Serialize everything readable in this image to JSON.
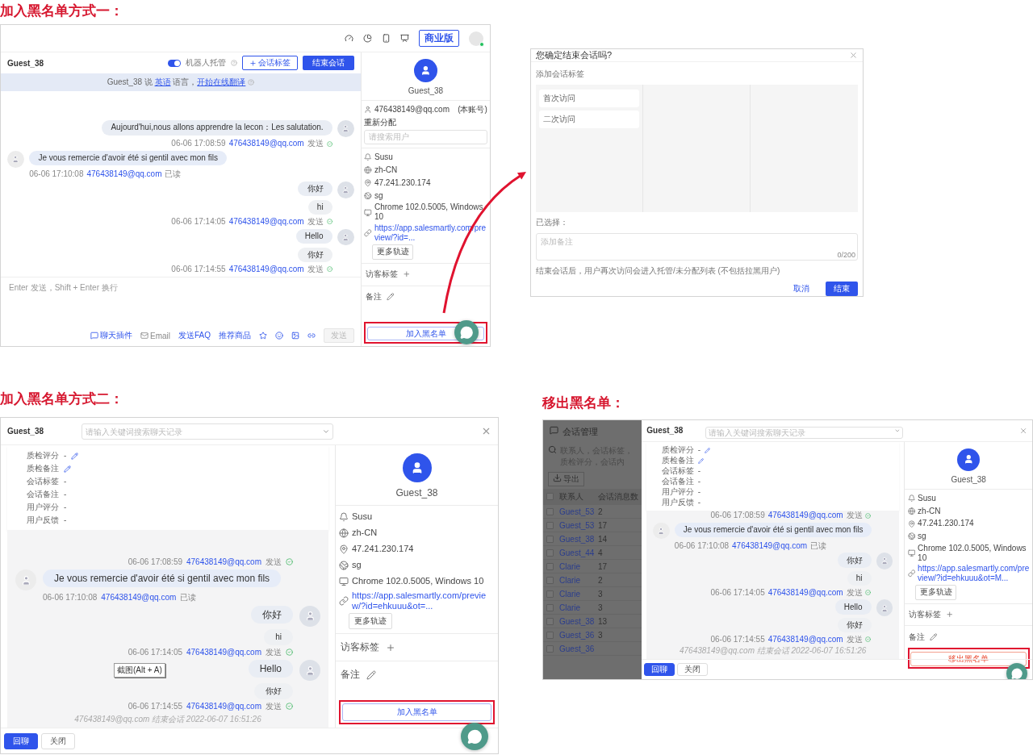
{
  "method_one": {
    "heading": "加入黑名单方式一：",
    "workspace": {
      "topbar": {
        "plan_badge": "商业版",
        "online": true
      },
      "chat": {
        "guest": "Guest_38",
        "robot_toggle": {
          "label": "机器人托管",
          "on": true
        },
        "tag_button": "会话标签",
        "end_button": "结束会话",
        "translate_notice": [
          {
            "text": "Guest_38 说 ",
            "link": false
          },
          {
            "text": "英语",
            "link": true
          },
          {
            "text": " 语言，",
            "link": false
          },
          {
            "text": "开始在线翻译",
            "link": true
          }
        ],
        "messages": [
          {
            "kind": "sent",
            "bubbles": [
              {
                "text": "Aujourd'hui,nous allons apprendre la lecon：Les salutation.",
                "kind": "original"
              }
            ],
            "time": "06-06 17:08:59",
            "account": "476438149@qq.com",
            "status": "发送",
            "delivered": true
          },
          {
            "kind": "received",
            "bubbles": [
              {
                "text": "Je vous remercie d'avoir été si gentil avec mon fils",
                "kind": "original"
              }
            ],
            "time": "06-06 17:10:08",
            "account": "476438149@qq.com",
            "status": "已读",
            "delivered": false
          },
          {
            "kind": "sent",
            "bubbles": [
              {
                "text": "你好",
                "kind": "original"
              },
              {
                "text": "hi",
                "kind": "translation"
              }
            ],
            "time": "06-06 17:14:05",
            "account": "476438149@qq.com",
            "status": "发送",
            "delivered": true
          },
          {
            "kind": "sent",
            "bubbles": [
              {
                "text": "Hello",
                "kind": "original"
              },
              {
                "text": "你好",
                "kind": "translation"
              }
            ],
            "time": "06-06 17:14:55",
            "account": "476438149@qq.com",
            "status": "发送",
            "delivered": true
          }
        ],
        "composer_placeholder": "Enter 发送，Shift + Enter 换行",
        "tools": [
          {
            "kind": "plugin",
            "label": "聊天插件"
          },
          {
            "kind": "email",
            "label": "Email"
          },
          {
            "kind": "link",
            "label": "发送FAQ"
          },
          {
            "kind": "link",
            "label": "推荐商品"
          }
        ],
        "send_button": {
          "label": "发送",
          "disabled": true
        }
      },
      "visitor": {
        "name": "Guest_38",
        "account": "476438149@qq.com",
        "account_note": "(本账号)",
        "reassign_label": "重新分配",
        "reassign_placeholder": "请搜索用户",
        "info": [
          {
            "kind": "name",
            "text": "Susu"
          },
          {
            "kind": "language",
            "text": "zh-CN"
          },
          {
            "kind": "ip",
            "text": "47.241.230.174"
          },
          {
            "kind": "region",
            "text": "sg"
          },
          {
            "kind": "device",
            "text": "Chrome 102.0.5005, Windows 10"
          },
          {
            "kind": "url",
            "text": "https://app.salesmartly.com/preview/?id=..."
          }
        ],
        "more_button": "更多轨迹",
        "tags_label": "访客标签",
        "notes_label": "备注",
        "blacklist_button": {
          "label": "加入黑名单",
          "kind": "add"
        }
      }
    },
    "end_dialog": {
      "title": "您确定结束会话吗?",
      "tags_label": "添加会话标签",
      "tag_columns": [
        [
          "首次访问",
          "二次访问"
        ]
      ],
      "selected_label": "已选择：",
      "note_placeholder": "添加备注",
      "note_counter": "0/200",
      "hint": "结束会话后，用户再次访问会进入托管/未分配列表 (不包括拉黑用户)",
      "buttons": [
        {
          "label": "取消",
          "kind": "text"
        },
        {
          "label": "结束",
          "kind": "primary"
        }
      ]
    }
  },
  "method_two": {
    "heading": "加入黑名单方式二：",
    "history": {
      "guest": "Guest_38",
      "search_placeholder": "请输入关键词搜索聊天记录",
      "fields": [
        {
          "name": "质检评分",
          "entry": "-",
          "editable": true
        },
        {
          "name": "质检备注",
          "editable": true
        },
        {
          "name": "会话标签",
          "entry": "-",
          "editable": false
        },
        {
          "name": "会话备注",
          "entry": "-",
          "editable": false
        },
        {
          "name": "用户评分",
          "entry": "-",
          "editable": false
        },
        {
          "name": "用户反馈",
          "entry": "-",
          "editable": false
        }
      ],
      "messages": [
        {
          "kind": "sent",
          "time": "06-06 17:08:59",
          "account": "476438149@qq.com",
          "status": "发送",
          "delivered": true
        },
        {
          "kind": "received",
          "bubbles": [
            {
              "text": "Je vous remercie d'avoir été si gentil avec mon fils",
              "kind": "original"
            }
          ],
          "time": "06-06 17:10:08",
          "account": "476438149@qq.com",
          "status": "已读",
          "delivered": false
        },
        {
          "kind": "sent",
          "bubbles": [
            {
              "text": "你好",
              "kind": "original"
            },
            {
              "text": "hi",
              "kind": "translation"
            }
          ],
          "time": "06-06 17:14:05",
          "account": "476438149@qq.com",
          "status": "发送",
          "delivered": true
        },
        {
          "kind": "sent",
          "bubbles": [
            {
              "text": "Hello",
              "kind": "original"
            },
            {
              "text": "你好",
              "kind": "translation"
            }
          ],
          "time": "06-06 17:14:55",
          "account": "476438149@qq.com",
          "status": "发送",
          "delivered": true
        }
      ],
      "end_note": "476438149@qq.com 结束会话 2022-06-07 16:51:26",
      "tooltip": "截图(Alt + A)",
      "visitor": {
        "name": "Guest_38",
        "info": [
          {
            "kind": "name",
            "text": "Susu"
          },
          {
            "kind": "language",
            "text": "zh-CN"
          },
          {
            "kind": "ip",
            "text": "47.241.230.174"
          },
          {
            "kind": "region",
            "text": "sg"
          },
          {
            "kind": "device",
            "text": "Chrome 102.0.5005, Windows 10"
          },
          {
            "kind": "url",
            "text": "https://app.salesmartly.com/preview/?id=ehkuuu&ot=..."
          }
        ],
        "more_button": "更多轨迹",
        "tags_label": "访客标签",
        "notes_label": "备注",
        "blacklist_button": {
          "label": "加入黑名单",
          "kind": "add"
        }
      },
      "footer_buttons": [
        {
          "label": "回聊",
          "kind": "primary"
        },
        {
          "label": "关闭",
          "kind": "default"
        }
      ]
    }
  },
  "removal": {
    "heading": "移出黑名单：",
    "session_list": {
      "title": "会话管理",
      "search_placeholder": "联系人，会话标签，质检评分，会话内",
      "export_button": "导出",
      "columns": [
        "联系人",
        "会话消息数"
      ],
      "all_checked": false,
      "rows": [
        {
          "contact": "Guest_53",
          "count": "2",
          "checked": false
        },
        {
          "contact": "Guest_53",
          "count": "17",
          "checked": false
        },
        {
          "contact": "Guest_38",
          "count": "14",
          "checked": false
        },
        {
          "contact": "Guest_44",
          "count": "4",
          "checked": false
        },
        {
          "contact": "Clarie",
          "count": "17",
          "checked": false
        },
        {
          "contact": "Clarie",
          "count": "2",
          "checked": false
        },
        {
          "contact": "Clarie",
          "count": "3",
          "checked": false
        },
        {
          "contact": "Clarie",
          "count": "3",
          "checked": false
        },
        {
          "contact": "Guest_38",
          "count": "13",
          "checked": false
        },
        {
          "contact": "Guest_36",
          "count": "3",
          "checked": false
        },
        {
          "contact": "Guest_36",
          "checked": false
        }
      ]
    },
    "history": {
      "guest": "Guest_38",
      "search_placeholder": "请输入关键词搜索聊天记录",
      "fields": [
        {
          "name": "质检评分",
          "entry": "-",
          "editable": true
        },
        {
          "name": "质检备注",
          "editable": true
        },
        {
          "name": "会话标签",
          "entry": "-",
          "editable": false
        },
        {
          "name": "会话备注",
          "entry": "-",
          "editable": false
        },
        {
          "name": "用户评分",
          "entry": "-",
          "editable": false
        },
        {
          "name": "用户反馈",
          "entry": "-",
          "editable": false
        }
      ],
      "messages": [
        {
          "kind": "sent",
          "time": "06-06 17:08:59",
          "account": "476438149@qq.com",
          "status": "发送",
          "delivered": true
        },
        {
          "kind": "received",
          "bubbles": [
            {
              "text": "Je vous remercie d'avoir été si gentil avec mon fils",
              "kind": "original"
            }
          ],
          "time": "06-06 17:10:08",
          "account": "476438149@qq.com",
          "status": "已读",
          "delivered": false
        },
        {
          "kind": "sent",
          "bubbles": [
            {
              "text": "你好",
              "kind": "original"
            },
            {
              "text": "hi",
              "kind": "translation"
            }
          ],
          "time": "06-06 17:14:05",
          "account": "476438149@qq.com",
          "status": "发送",
          "delivered": true
        },
        {
          "kind": "sent",
          "bubbles": [
            {
              "text": "Hello",
              "kind": "original"
            },
            {
              "text": "你好",
              "kind": "translation"
            }
          ],
          "time": "06-06 17:14:55",
          "account": "476438149@qq.com",
          "status": "发送",
          "delivered": true
        }
      ],
      "end_note": "476438149@qq.com 结束会话 2022-06-07 16:51:26",
      "visitor": {
        "name": "Guest_38",
        "info": [
          {
            "kind": "name",
            "text": "Susu"
          },
          {
            "kind": "language",
            "text": "zh-CN"
          },
          {
            "kind": "ip",
            "text": "47.241.230.174"
          },
          {
            "kind": "region",
            "text": "sg"
          },
          {
            "kind": "device",
            "text": "Chrome 102.0.5005, Windows 10"
          },
          {
            "kind": "url",
            "text": "https://app.salesmartly.com/preview/?id=ehkuuu&ot=M..."
          }
        ],
        "more_button": "更多轨迹",
        "tags_label": "访客标签",
        "notes_label": "备注",
        "blacklist_button": {
          "label": "移出黑名单",
          "kind": "remove"
        }
      },
      "footer_buttons": [
        {
          "label": "回聊",
          "kind": "primary"
        },
        {
          "label": "关闭",
          "kind": "default"
        }
      ]
    }
  }
}
